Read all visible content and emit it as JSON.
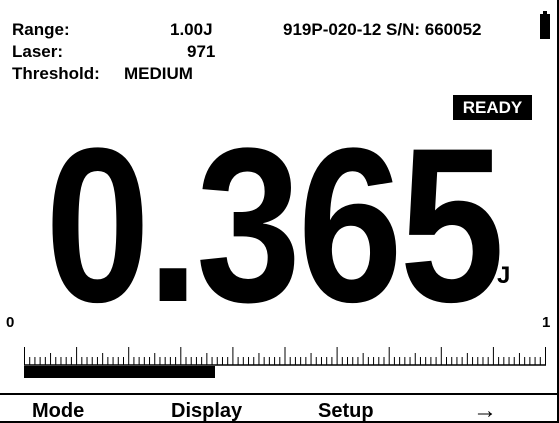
{
  "status": {
    "range_label": "Range:",
    "range_value": "1.00J",
    "laser_label": "Laser:",
    "laser_value": "971",
    "threshold_label": "Threshold:",
    "threshold_value": "MEDIUM",
    "device_id": "919P-020-12 S/N: 660052",
    "battery_icon": "battery-full-icon",
    "ready_badge": "READY"
  },
  "reading": {
    "value": "0.365",
    "unit": "J"
  },
  "scale": {
    "min_label": "0",
    "max_label": "1",
    "fraction_filled": 0.365
  },
  "softkeys": {
    "mode": "Mode",
    "display": "Display",
    "setup": "Setup",
    "next": "→"
  },
  "colors": {
    "foreground": "#000000",
    "background": "#ffffff"
  }
}
